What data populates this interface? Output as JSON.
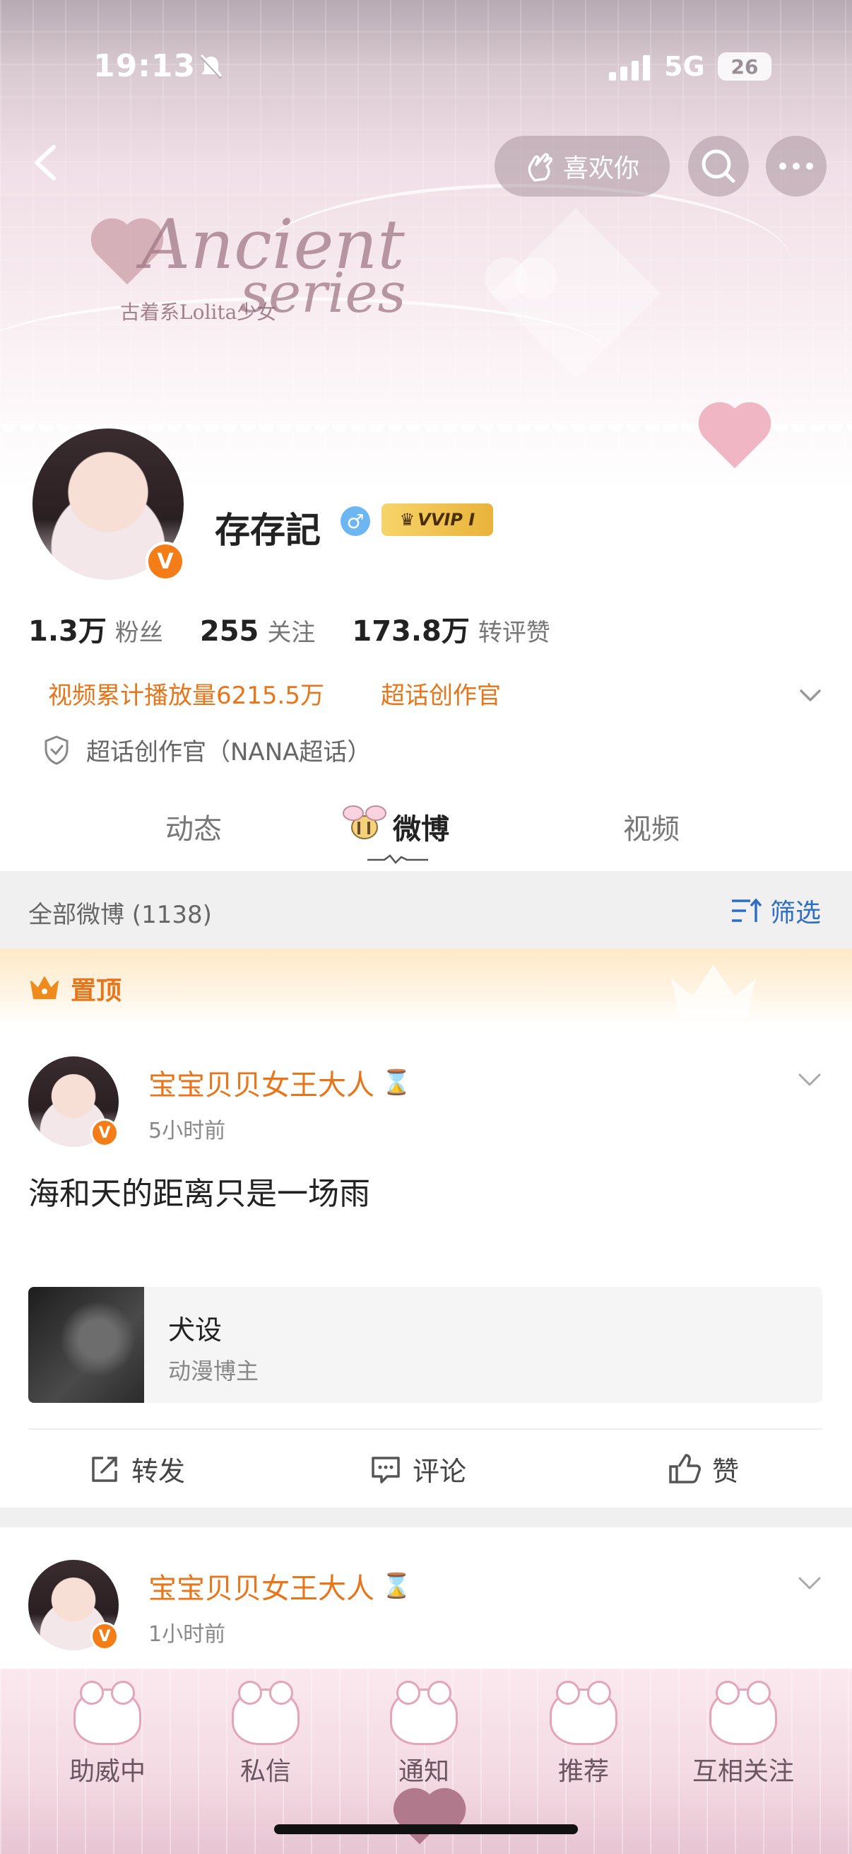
{
  "status_bar": {
    "time": "19:13",
    "network": "5G",
    "battery": "26"
  },
  "header": {
    "like_button_label": "喜欢你",
    "banner_text_1": "Ancient",
    "banner_text_2": "series",
    "banner_text_3": "古着系Lolita少女"
  },
  "profile": {
    "username": "存存記",
    "vip_label": "VVIP I",
    "stats": [
      {
        "value": "1.3万",
        "label": "粉丝"
      },
      {
        "value": "255",
        "label": "关注"
      },
      {
        "value": "173.8万",
        "label": "转评赞"
      }
    ],
    "tags": [
      "视频累计播放量6215.5万",
      "超话创作官"
    ],
    "certification": "超话创作官（NANA超话）"
  },
  "tabs": [
    {
      "label": "动态"
    },
    {
      "label": "微博"
    },
    {
      "label": "视频"
    }
  ],
  "feed": {
    "all_label": "全部微博 (1138)",
    "filter_label": "筛选",
    "pinned_label": "置顶"
  },
  "posts": [
    {
      "author": "宝宝贝贝女王大人",
      "time": "5小时前",
      "text": "海和天的距离只是一场雨",
      "card": {
        "title": "犬设",
        "subtitle": "动漫博主"
      },
      "actions": {
        "repost": "转发",
        "comment": "评论",
        "like": "赞"
      }
    },
    {
      "author": "宝宝贝贝女王大人",
      "time": "1小时前"
    }
  ],
  "bottom_nav": [
    {
      "label": "助威中"
    },
    {
      "label": "私信"
    },
    {
      "label": "通知"
    },
    {
      "label": "推荐"
    },
    {
      "label": "互相关注"
    }
  ],
  "colors": {
    "accent_orange": "#e8751a",
    "link_blue": "#2e6ec3",
    "v_badge": "#f47d17",
    "gender_blue": "#6cb7f2"
  },
  "icons": {
    "back": "chevron-left-icon",
    "like": "hand-heart-icon",
    "search": "search-icon",
    "more": "more-dots-icon",
    "gender": "male-icon",
    "cert": "shield-check-icon",
    "filter": "filter-sort-icon",
    "pinned": "crown-icon",
    "repost": "share-square-icon",
    "comment": "comment-icon",
    "like_action": "thumbs-up-icon"
  }
}
